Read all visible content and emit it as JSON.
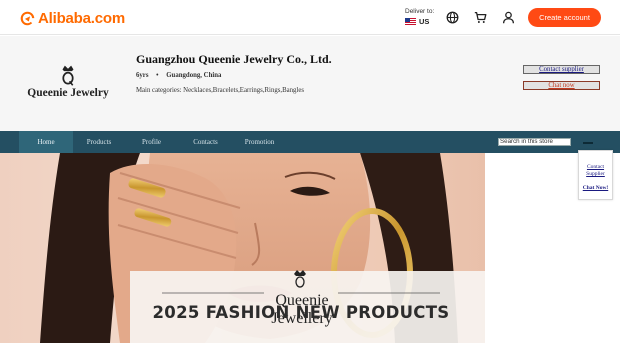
{
  "header": {
    "logo_text": "Alibaba.com",
    "deliver_label": "Deliver to:",
    "deliver_country": "US",
    "icons": [
      "globe-icon",
      "cart-icon",
      "user-icon"
    ],
    "create_account": "Create account",
    "accent_color": "#ff4a14"
  },
  "supplier": {
    "brand_name": "Queenie Jewelry",
    "company_name": "Guangzhou Queenie Jewelry Co., Ltd.",
    "years": "6yrs",
    "separator": "•",
    "location": "Guangdong, China",
    "categories": "Main categories: Necklaces,Bracelets,Earrings,Rings,Bangles",
    "contact_button": "Contact supplier",
    "chat_button": "Chat now"
  },
  "nav": {
    "items": [
      {
        "label": "Home",
        "active": true
      },
      {
        "label": "Products",
        "active": false
      },
      {
        "label": "Profile",
        "active": false
      },
      {
        "label": "Contacts",
        "active": false
      },
      {
        "label": "Promotion",
        "active": false
      }
    ],
    "search_value": "Search in this store",
    "bar_color": "#244f62"
  },
  "banner": {
    "brand": "Queenie Jewellery",
    "headline": "2025 FASHION NEW PRODUCTS"
  },
  "side_widget": {
    "contact": "Contact Supplier",
    "chat": "Chat Now!"
  }
}
